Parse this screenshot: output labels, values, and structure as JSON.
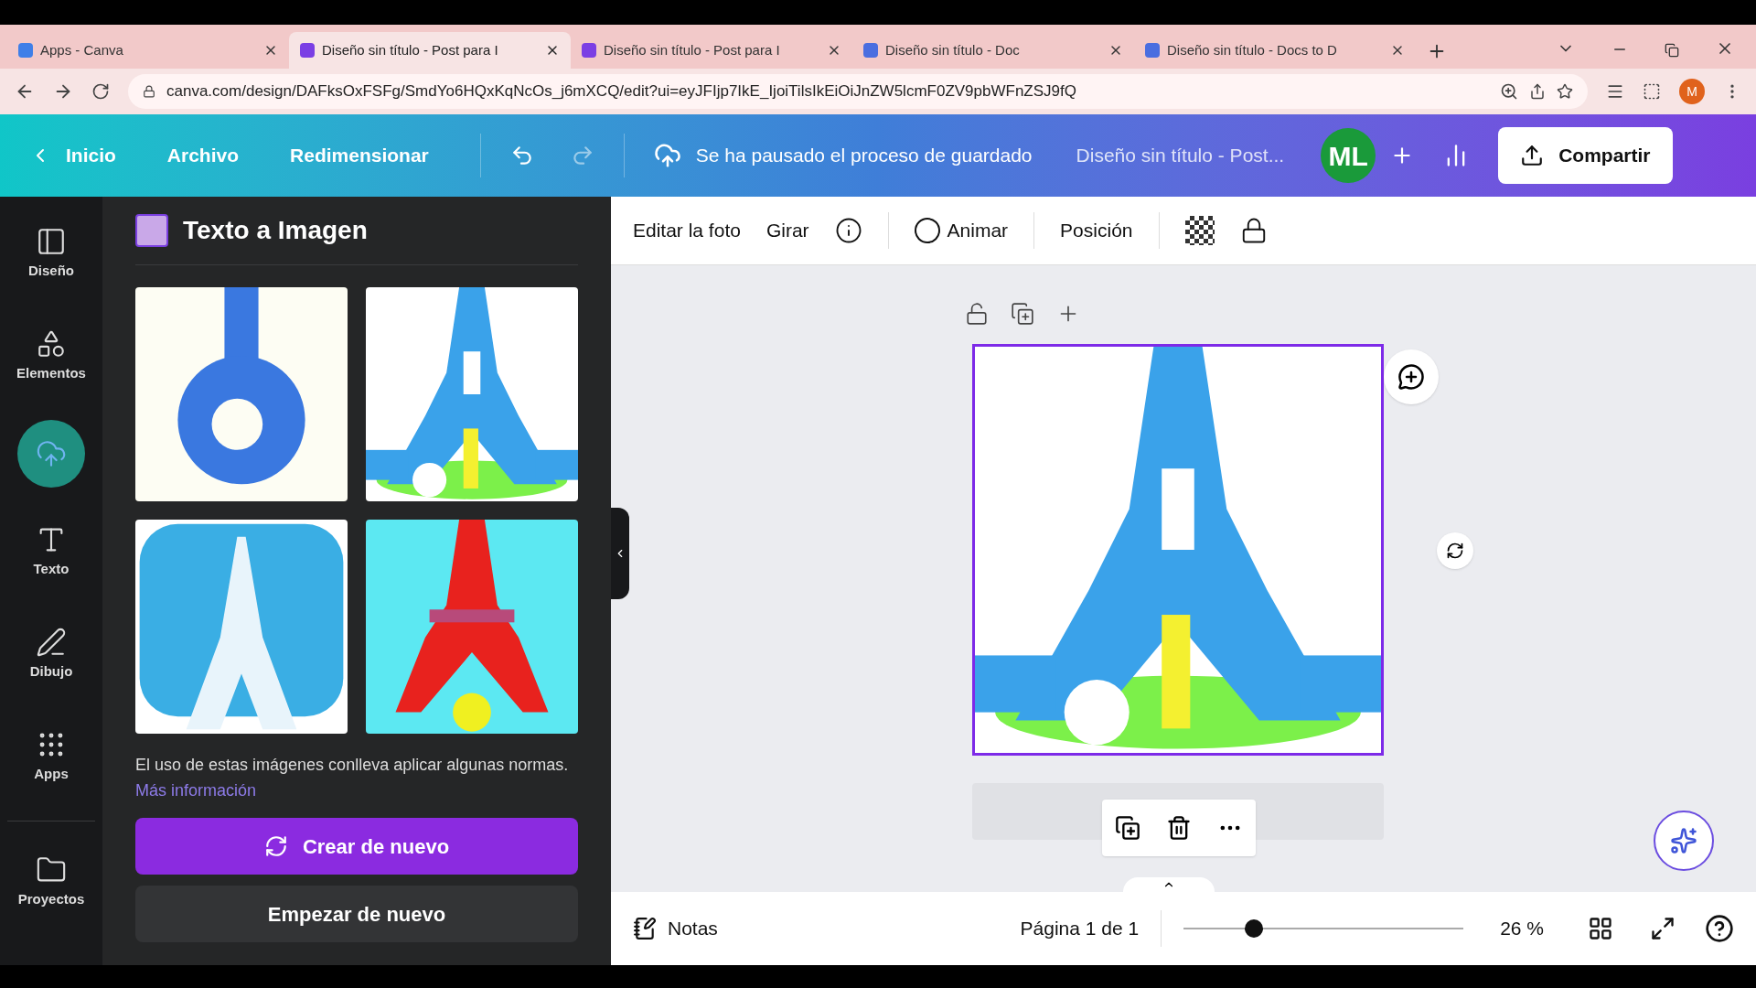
{
  "browser": {
    "tabs": [
      {
        "title": "Apps - Canva",
        "selected": false
      },
      {
        "title": "Diseño sin título - Post para I",
        "selected": true
      },
      {
        "title": "Diseño sin título - Post para I",
        "selected": false
      },
      {
        "title": "Diseño sin título - Doc",
        "selected": false
      },
      {
        "title": "Diseño sin título - Docs to D",
        "selected": false
      }
    ],
    "url": "canva.com/design/DAFksOxFSFg/SmdYo6HQxKqNcOs_j6mXCQ/edit?ui=eyJFIjp7IkE_IjoiTilsIkEiOiJnZW5lcmF0ZV9pbWFnZSJ9fQ",
    "profile": "M"
  },
  "header": {
    "back": "Inicio",
    "menu": [
      "Archivo",
      "Redimensionar"
    ],
    "save_status": "Se ha pausado el proceso de guardado",
    "title": "Diseño sin título - Post...",
    "avatar": "ML",
    "share": "Compartir"
  },
  "sidebar": {
    "items": [
      {
        "label": "Diseño",
        "kind": "layout",
        "selected": false
      },
      {
        "label": "Elementos",
        "kind": "shapes",
        "selected": false
      },
      {
        "kind": "upload",
        "selected": true
      },
      {
        "label": "Texto",
        "kind": "text",
        "selected": false
      },
      {
        "label": "Dibujo",
        "kind": "draw",
        "selected": false
      },
      {
        "label": "Apps",
        "kind": "apps",
        "selected": false
      },
      {
        "label": "Proyectos",
        "kind": "folder",
        "selected": false
      }
    ]
  },
  "panel": {
    "title": "Texto a Imagen",
    "notice": "El uso de estas imágenes conlleva aplicar algunas normas.",
    "notice_link": "Más información",
    "primary": "Crear de nuevo",
    "secondary": "Empezar de nuevo"
  },
  "toolbar": {
    "items": [
      "Editar la foto",
      "Girar"
    ],
    "animate": "Animar",
    "position": "Posición"
  },
  "footer": {
    "notes": "Notas",
    "page": "Página 1 de 1",
    "zoom": {
      "level": 0.25
    },
    "zoom_reading": "26 %"
  }
}
